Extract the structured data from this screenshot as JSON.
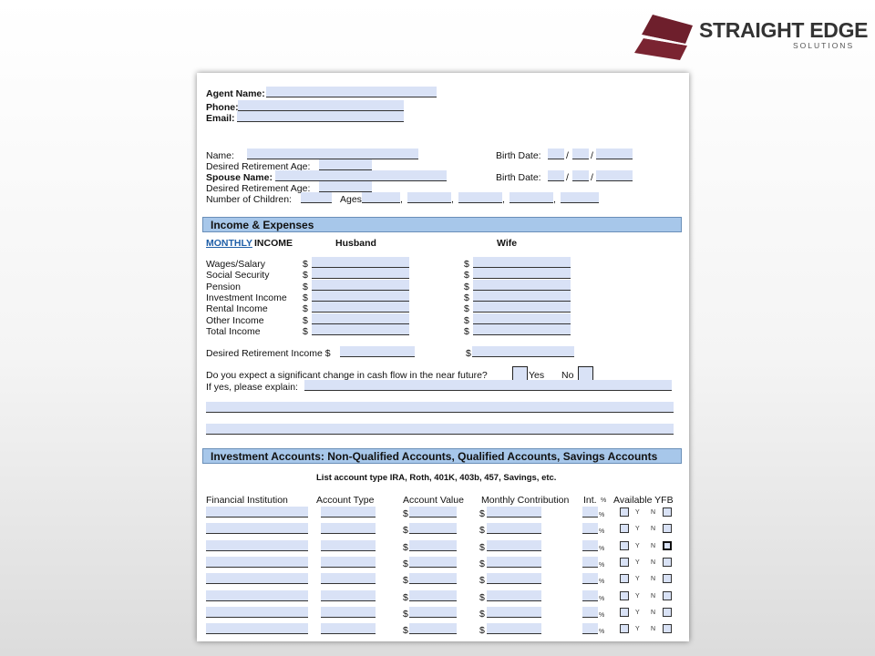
{
  "logo": {
    "title": "STRAIGHT EDGE",
    "subtitle": "SOLUTIONS"
  },
  "agent": {
    "name": "Agent Name:",
    "phone": "Phone:",
    "email": "Email:"
  },
  "personal": {
    "name": "Name:",
    "birth_date": "Birth Date:",
    "desired_retirement_age": "Desired Retirement Age:",
    "spouse_name": "Spouse Name:",
    "num_children": "Number of Children:",
    "ages": "Ages",
    "date_sep": "/",
    "comma": ","
  },
  "income": {
    "header": "Income & Expenses",
    "monthly": "MONTHLY",
    "income_word": "INCOME",
    "husband": "Husband",
    "wife": "Wife",
    "rows": [
      "Wages/Salary",
      "Social Security",
      "Pension",
      "Investment Income",
      "Rental Income",
      "Other Income",
      "Total Income"
    ],
    "dollar": "$",
    "desired_retirement_income": "Desired Retirement Income $",
    "question": "Do you expect a significant change in cash flow in the near future?",
    "yes": "Yes",
    "no": "No",
    "explain": "If yes, please explain:"
  },
  "investment": {
    "header": "Investment Accounts:  Non-Qualified Accounts, Qualified Accounts, Savings Accounts",
    "note": "List account type IRA, Roth, 401K, 403b, 457, Savings, etc.",
    "columns": {
      "institution": "Financial Institution",
      "type": "Account Type",
      "value": "Account Value",
      "contribution": "Monthly Contribution",
      "int": "Int.",
      "pct": "%",
      "available": "Available YFB"
    },
    "dollar": "$",
    "y": "Y",
    "n": "N",
    "rows": 8,
    "checked_row": 2
  }
}
